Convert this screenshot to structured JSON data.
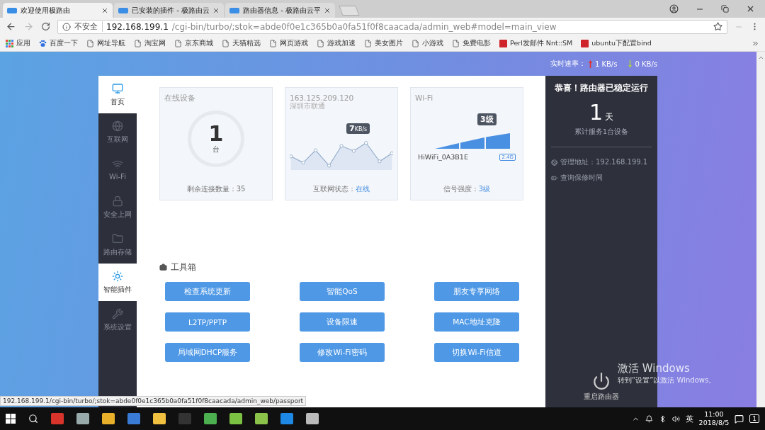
{
  "browser": {
    "tabs": [
      {
        "title": "欢迎使用极路由",
        "selected": true
      },
      {
        "title": "已安装的插件 - 极路由云",
        "selected": false
      },
      {
        "title": "路由器信息 - 极路由云平",
        "selected": false
      }
    ],
    "address_bar": {
      "security": "不安全",
      "host": "192.168.199.1",
      "path": "/cgi-bin/turbo/;stok=abde0f0e1c365b0a0fa51f0f8caacada/admin_web#model=main_view"
    },
    "bookmarks": [
      {
        "kind": "apps",
        "label": "应用"
      },
      {
        "kind": "paw",
        "label": "百度一下"
      },
      {
        "kind": "page",
        "label": "网址导航"
      },
      {
        "kind": "page",
        "label": "淘宝网"
      },
      {
        "kind": "page",
        "label": "京东商城"
      },
      {
        "kind": "page",
        "label": "天猫精选"
      },
      {
        "kind": "page",
        "label": "网页游戏"
      },
      {
        "kind": "page",
        "label": "游戏加速"
      },
      {
        "kind": "page",
        "label": "美女图片"
      },
      {
        "kind": "page",
        "label": "小游戏"
      },
      {
        "kind": "page",
        "label": "免费电影"
      },
      {
        "kind": "c",
        "label": "Perl发邮件 Nnt::SM"
      },
      {
        "kind": "c",
        "label": "ubuntu下配置bind"
      }
    ]
  },
  "rate": {
    "label": "实时速率：",
    "up": "1 KB/s",
    "down": "0 KB/s"
  },
  "sidebar": [
    {
      "kind": "monitor",
      "label": "首页",
      "selected": true
    },
    {
      "kind": "globe",
      "label": "互联网",
      "selected": false
    },
    {
      "kind": "wifi",
      "label": "Wi-Fi",
      "selected": false
    },
    {
      "kind": "lock",
      "label": "安全上网",
      "selected": false
    },
    {
      "kind": "folder",
      "label": "路由存储",
      "selected": false
    },
    {
      "kind": "sun",
      "label": "智能插件",
      "selected": true
    },
    {
      "kind": "wrench",
      "label": "系统设置",
      "selected": false
    }
  ],
  "online_devices": {
    "title": "在线设备",
    "count": "1",
    "unit": "台",
    "footer_label": "剩余连接数量：",
    "footer_value": "35"
  },
  "internet": {
    "ip": "163.125.209.120",
    "isp": "深圳市联通",
    "speed": "7",
    "speed_unit": "KB/s",
    "footer_label": "互联网状态：",
    "footer_value": "在线"
  },
  "wifi": {
    "title": "Wi-Fi",
    "level_badge": "3级",
    "ssid": "HiWiFi_0A3B1E",
    "band": "2.4G",
    "footer_label": "信号强度：",
    "footer_value": "3级"
  },
  "toolbox": {
    "title": "工具箱",
    "buttons": [
      "检查系统更新",
      "智能QoS",
      "朋友专享网络",
      "L2TP/PPTP",
      "设备限速",
      "MAC地址克隆",
      "局域网DHCP服务",
      "修改Wi-Fi密码",
      "切换Wi-Fi信道"
    ]
  },
  "status_panel": {
    "title": "恭喜！路由器已稳定运行",
    "days": "1",
    "days_unit": "天",
    "served": "累计服务1台设备",
    "admin": "管理地址：192.168.199.1",
    "warranty": "查询保修时间",
    "reboot": "重启路由器"
  },
  "activation": {
    "title": "激活 Windows",
    "hint": "转到“设置”以激活 Windows。"
  },
  "status_url": "192.168.199.1/cgi-bin/turbo/;stok=abde0f0e1c365b0a0fa51f0f8caacada/admin_web/passport",
  "taskbar": {
    "ime": "英",
    "time": "11:00",
    "date": "2018/8/5",
    "notifications": "1"
  }
}
